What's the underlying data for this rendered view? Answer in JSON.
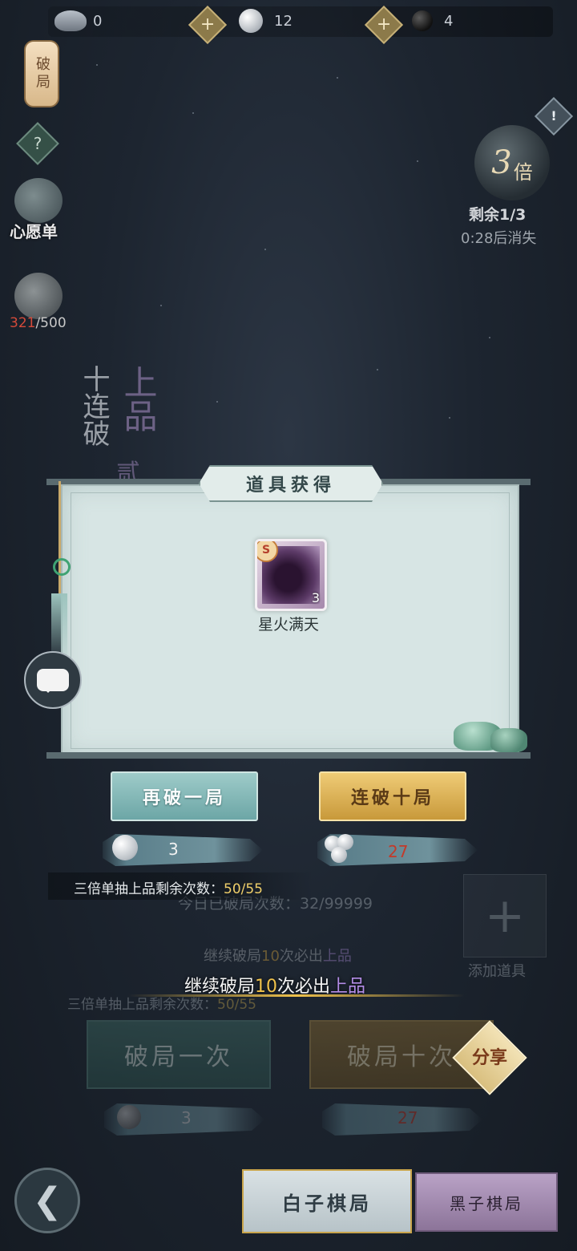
{
  "resources": {
    "ingot": "0",
    "white_stones": "12",
    "black_stones": "4"
  },
  "side": {
    "lantern_label": "破局",
    "help_symbol": "?",
    "wishlist_label": "心愿单",
    "bag_current": "321",
    "bag_max": "/500"
  },
  "multiplier": {
    "value": "3",
    "unit": "倍",
    "warning_symbol": "!",
    "remaining": "剩余1/3",
    "timer": "0:28后消失"
  },
  "background_banner": {
    "vertical_text": "十连破",
    "upper_text": "上品",
    "mark": "贰"
  },
  "dialog": {
    "title": "道具获得",
    "item": {
      "name": "星火满天",
      "quantity": "3",
      "badge": "S"
    },
    "retry_button": "再破一局",
    "ten_button": "连破十局",
    "retry_cost": "3",
    "ten_cost": "27",
    "quota_label": "三倍单抽上品剩余次数：",
    "quota_value": "50/55"
  },
  "main": {
    "today_count": "今日已破局次数：32/99999",
    "add_item_label": "添加道具",
    "guarantee_prefix": "继续破局",
    "guarantee_number": "10",
    "guarantee_middle": "次必出",
    "guarantee_quality": "上品",
    "quota_label": "三倍单抽上品剩余次数：",
    "quota_value": "50/55",
    "single_button": "破局一次",
    "ten_button": "破局十次",
    "share_button": "分享",
    "single_cost": "3",
    "ten_cost": "27"
  },
  "bottom_nav": {
    "back_symbol": "❮",
    "tab_white": "白子棋局",
    "tab_black": "黑子棋局"
  },
  "colors": {
    "accent_gold": "#f0c24b",
    "accent_purple": "#b48de8",
    "cost_red": "#c33a2a",
    "dialog_bg": "#d7e5e4"
  }
}
